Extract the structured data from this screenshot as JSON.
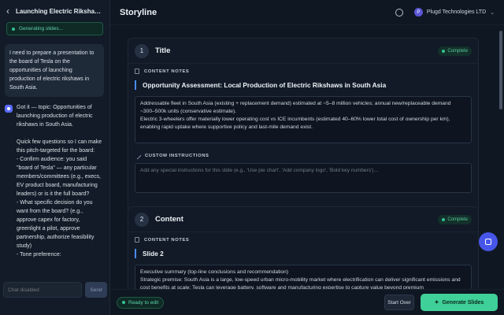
{
  "chat": {
    "title": "Launching Electric Rikshaws in...",
    "status": "Generating slides...",
    "user_message": "I need to prepare a presentation to the board of Tesla on the opportunities of launching production of electric rikshaws in South Asia.",
    "bot_message": "Got it — topic: Opportunities of launching production of electric rikshaws in South Asia.\n\nQuick few questions so I can make this pitch-targeted for the board:\n- Confirm audience: you said \"board of Tesla\" — any particular members/committees (e.g., execs, EV product board, manufacturing leaders) or is it the full board?\n- What specific decision do you want from the board? (e.g., approve capex for factory, greenlight a pilot, approve partnership, authorize feasibility study)\n- Tone preference:",
    "input_placeholder": "Chat disabled",
    "send_label": "Send"
  },
  "header": {
    "brand": "Storyline",
    "org_initial": "P",
    "org_name": "Plugd Technologies LTD"
  },
  "slides": [
    {
      "number": "1",
      "title": "Title",
      "status": "Complete",
      "content_label": "CONTENT NOTES",
      "heading": "Opportunity Assessment: Local Production of Electric Rikshaws in South Asia",
      "notes": "Addressable fleet in South Asia (existing + replacement demand) estimated at ~5–8 million vehicles; annual new/replaceable demand ~300–500k units (conservative estimate).\nElectric 3-wheelers offer materially lower operating cost vs ICE incumbents (estimated 40–60% lower total cost of ownership per km), enabling rapid uptake where supportive policy and last-mile demand exist.",
      "instr_label": "CUSTOM INSTRUCTIONS",
      "instr_placeholder": "Add any special instructions for this slide (e.g., 'Use pie chart', 'Add company logo', 'Bold key numbers')..."
    },
    {
      "number": "2",
      "title": "Content",
      "status": "Complete",
      "content_label": "CONTENT NOTES",
      "heading": "Slide 2",
      "notes": "Executive summary (top-line conclusions and recommendation)\nStrategic premise: South Asia is a large, low-speed urban micro-mobility market where electrification can deliver significant emissions and cost benefits at scale; Tesla can leverage battery, software and manufacturing expertise to capture value beyond premium"
    }
  ],
  "footer": {
    "ready": "Ready to edit",
    "start_over": "Start Over",
    "generate": "Generate Slides"
  }
}
